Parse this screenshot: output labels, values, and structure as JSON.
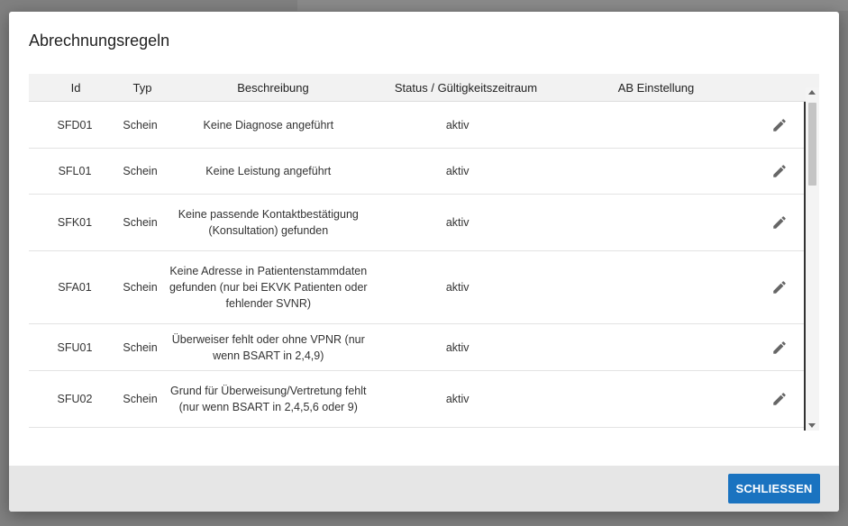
{
  "dialog": {
    "title": "Abrechnungsregeln",
    "close_label": "SCHLIESSEN"
  },
  "table": {
    "columns": {
      "id": "Id",
      "typ": "Typ",
      "beschreibung": "Beschreibung",
      "status": "Status / Gültigkeitszeitraum",
      "ab": "AB Einstellung"
    },
    "rows": [
      {
        "id": "SFD01",
        "typ": "Schein",
        "beschreibung": "Keine Diagnose angeführt",
        "status": "aktiv",
        "ab": ""
      },
      {
        "id": "SFL01",
        "typ": "Schein",
        "beschreibung": "Keine Leistung angeführt",
        "status": "aktiv",
        "ab": ""
      },
      {
        "id": "SFK01",
        "typ": "Schein",
        "beschreibung": "Keine passende Kontaktbestätigung (Konsultation) gefunden",
        "status": "aktiv",
        "ab": ""
      },
      {
        "id": "SFA01",
        "typ": "Schein",
        "beschreibung": "Keine Adresse in Patientenstammdaten gefunden (nur bei EKVK Patienten oder fehlender SVNR)",
        "status": "aktiv",
        "ab": ""
      },
      {
        "id": "SFU01",
        "typ": "Schein",
        "beschreibung": "Überweiser fehlt oder ohne VPNR (nur wenn BSART in 2,4,9)",
        "status": "aktiv",
        "ab": ""
      },
      {
        "id": "SFU02",
        "typ": "Schein",
        "beschreibung": "Grund für Überweisung/Vertretung fehlt (nur wenn BSART in 2,4,5,6 oder 9)",
        "status": "aktiv",
        "ab": ""
      }
    ]
  },
  "icons": {
    "edit": "pencil-icon"
  }
}
